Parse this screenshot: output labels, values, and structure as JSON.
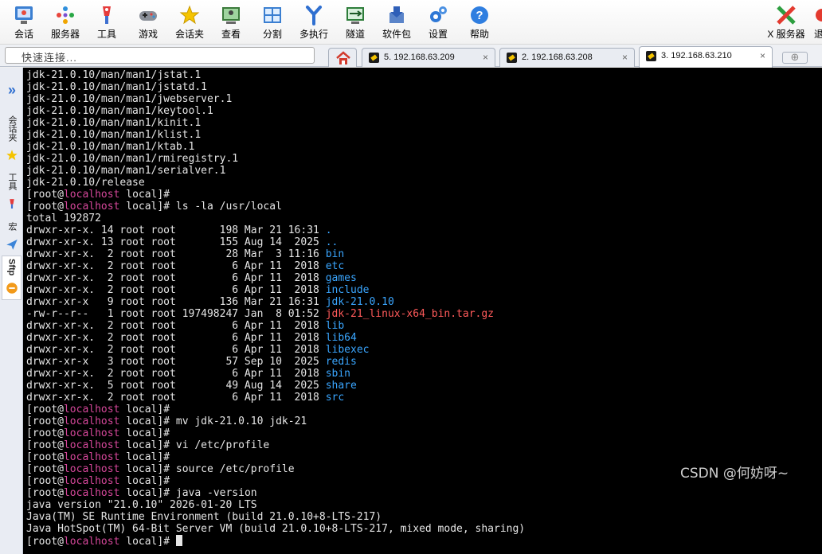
{
  "toolbar": {
    "items": [
      {
        "label": "会话",
        "icon": "session-icon"
      },
      {
        "label": "服务器",
        "icon": "servers-icon"
      },
      {
        "label": "工具",
        "icon": "tools-icon"
      },
      {
        "label": "游戏",
        "icon": "games-icon"
      },
      {
        "label": "会话夹",
        "icon": "star-icon"
      },
      {
        "label": "查看",
        "icon": "view-icon"
      },
      {
        "label": "分割",
        "icon": "split-icon"
      },
      {
        "label": "多执行",
        "icon": "multiexec-icon"
      },
      {
        "label": "隧道",
        "icon": "tunnel-icon"
      },
      {
        "label": "软件包",
        "icon": "packages-icon"
      },
      {
        "label": "设置",
        "icon": "settings-icon"
      },
      {
        "label": "帮助",
        "icon": "help-icon"
      }
    ],
    "x_server": {
      "label": "X 服务器",
      "icon": "x-server-icon"
    },
    "exit_label": "退"
  },
  "quick_connect": {
    "placeholder": "快速连接..."
  },
  "tabs": [
    {
      "label": "5. 192.168.63.209",
      "close": "×"
    },
    {
      "label": "2. 192.168.63.208",
      "close": "×"
    },
    {
      "label": "3. 192.168.63.210",
      "close": "×",
      "active": true
    }
  ],
  "new_tab": "⊕",
  "sidebar": {
    "items": [
      {
        "label": "会话夹",
        "icon": "star-icon"
      },
      {
        "label": "工具",
        "icon": "tools-icon"
      },
      {
        "label": "宏",
        "icon": "macros-icon"
      },
      {
        "label": "Sftp",
        "icon": "sftp-icon"
      }
    ]
  },
  "terminal": {
    "colors": {
      "background": "#000000",
      "text": "#e6e6e6",
      "host": "#d5479a",
      "directory": "#3aa6ff",
      "archive": "#ff5a5a"
    },
    "lines": [
      {
        "segments": [
          {
            "text": "jdk-21.0.10/man/man1/jstat.1"
          }
        ]
      },
      {
        "segments": [
          {
            "text": "jdk-21.0.10/man/man1/jstatd.1"
          }
        ]
      },
      {
        "segments": [
          {
            "text": "jdk-21.0.10/man/man1/jwebserver.1"
          }
        ]
      },
      {
        "segments": [
          {
            "text": "jdk-21.0.10/man/man1/keytool.1"
          }
        ]
      },
      {
        "segments": [
          {
            "text": "jdk-21.0.10/man/man1/kinit.1"
          }
        ]
      },
      {
        "segments": [
          {
            "text": "jdk-21.0.10/man/man1/klist.1"
          }
        ]
      },
      {
        "segments": [
          {
            "text": "jdk-21.0.10/man/man1/ktab.1"
          }
        ]
      },
      {
        "segments": [
          {
            "text": "jdk-21.0.10/man/man1/rmiregistry.1"
          }
        ]
      },
      {
        "segments": [
          {
            "text": "jdk-21.0.10/man/man1/serialver.1"
          }
        ]
      },
      {
        "segments": [
          {
            "text": "jdk-21.0.10/release"
          }
        ]
      },
      {
        "segments": [
          {
            "text": "[root@"
          },
          {
            "text": "localhost",
            "cls": "host"
          },
          {
            "text": " local]#"
          }
        ]
      },
      {
        "segments": [
          {
            "text": "[root@"
          },
          {
            "text": "localhost",
            "cls": "host"
          },
          {
            "text": " local]# ls -la /usr/local"
          }
        ]
      },
      {
        "segments": [
          {
            "text": "total 192872"
          }
        ]
      },
      {
        "segments": [
          {
            "text": "drwxr-xr-x. 14 root root       198 Mar 21 16:31 "
          },
          {
            "text": ".",
            "cls": "dir"
          }
        ]
      },
      {
        "segments": [
          {
            "text": "drwxr-xr-x. 13 root root       155 Aug 14  2025 "
          },
          {
            "text": "..",
            "cls": "dir"
          }
        ]
      },
      {
        "segments": [
          {
            "text": "drwxr-xr-x.  2 root root        28 Mar  3 11:16 "
          },
          {
            "text": "bin",
            "cls": "dir"
          }
        ]
      },
      {
        "segments": [
          {
            "text": "drwxr-xr-x.  2 root root         6 Apr 11  2018 "
          },
          {
            "text": "etc",
            "cls": "dir"
          }
        ]
      },
      {
        "segments": [
          {
            "text": "drwxr-xr-x.  2 root root         6 Apr 11  2018 "
          },
          {
            "text": "games",
            "cls": "dir"
          }
        ]
      },
      {
        "segments": [
          {
            "text": "drwxr-xr-x.  2 root root         6 Apr 11  2018 "
          },
          {
            "text": "include",
            "cls": "dir"
          }
        ]
      },
      {
        "segments": [
          {
            "text": "drwxr-xr-x   9 root root       136 Mar 21 16:31 "
          },
          {
            "text": "jdk-21.0.10",
            "cls": "dir"
          }
        ]
      },
      {
        "segments": [
          {
            "text": "-rw-r--r--   1 root root 197498247 Jan  8 01:52 "
          },
          {
            "text": "jdk-21_linux-x64_bin.tar.gz",
            "cls": "arc"
          }
        ]
      },
      {
        "segments": [
          {
            "text": "drwxr-xr-x.  2 root root         6 Apr 11  2018 "
          },
          {
            "text": "lib",
            "cls": "dir"
          }
        ]
      },
      {
        "segments": [
          {
            "text": "drwxr-xr-x.  2 root root         6 Apr 11  2018 "
          },
          {
            "text": "lib64",
            "cls": "dir"
          }
        ]
      },
      {
        "segments": [
          {
            "text": "drwxr-xr-x.  2 root root         6 Apr 11  2018 "
          },
          {
            "text": "libexec",
            "cls": "dir"
          }
        ]
      },
      {
        "segments": [
          {
            "text": "drwxr-xr-x   3 root root        57 Sep 10  2025 "
          },
          {
            "text": "redis",
            "cls": "dir"
          }
        ]
      },
      {
        "segments": [
          {
            "text": "drwxr-xr-x.  2 root root         6 Apr 11  2018 "
          },
          {
            "text": "sbin",
            "cls": "dir"
          }
        ]
      },
      {
        "segments": [
          {
            "text": "drwxr-xr-x.  5 root root        49 Aug 14  2025 "
          },
          {
            "text": "share",
            "cls": "dir"
          }
        ]
      },
      {
        "segments": [
          {
            "text": "drwxr-xr-x.  2 root root         6 Apr 11  2018 "
          },
          {
            "text": "src",
            "cls": "dir"
          }
        ]
      },
      {
        "segments": [
          {
            "text": "[root@"
          },
          {
            "text": "localhost",
            "cls": "host"
          },
          {
            "text": " local]#"
          }
        ]
      },
      {
        "segments": [
          {
            "text": "[root@"
          },
          {
            "text": "localhost",
            "cls": "host"
          },
          {
            "text": " local]# mv jdk-21.0.10 jdk-21"
          }
        ]
      },
      {
        "segments": [
          {
            "text": "[root@"
          },
          {
            "text": "localhost",
            "cls": "host"
          },
          {
            "text": " local]#"
          }
        ]
      },
      {
        "segments": [
          {
            "text": "[root@"
          },
          {
            "text": "localhost",
            "cls": "host"
          },
          {
            "text": " local]# vi /etc/profile"
          }
        ]
      },
      {
        "segments": [
          {
            "text": "[root@"
          },
          {
            "text": "localhost",
            "cls": "host"
          },
          {
            "text": " local]#"
          }
        ]
      },
      {
        "segments": [
          {
            "text": "[root@"
          },
          {
            "text": "localhost",
            "cls": "host"
          },
          {
            "text": " local]# source /etc/profile"
          }
        ]
      },
      {
        "segments": [
          {
            "text": "[root@"
          },
          {
            "text": "localhost",
            "cls": "host"
          },
          {
            "text": " local]#"
          }
        ]
      },
      {
        "segments": [
          {
            "text": "[root@"
          },
          {
            "text": "localhost",
            "cls": "host"
          },
          {
            "text": " local]# java -version"
          }
        ]
      },
      {
        "segments": [
          {
            "text": "java version \"21.0.10\" 2026-01-20 LTS"
          }
        ]
      },
      {
        "segments": [
          {
            "text": "Java(TM) SE Runtime Environment (build 21.0.10+8-LTS-217)"
          }
        ]
      },
      {
        "segments": [
          {
            "text": "Java HotSpot(TM) 64-Bit Server VM (build 21.0.10+8-LTS-217, mixed mode, sharing)"
          }
        ]
      },
      {
        "segments": [
          {
            "text": "[root@"
          },
          {
            "text": "localhost",
            "cls": "host"
          },
          {
            "text": " local]# "
          }
        ],
        "cursor": true
      }
    ]
  },
  "watermark": "CSDN @何妨呀~"
}
